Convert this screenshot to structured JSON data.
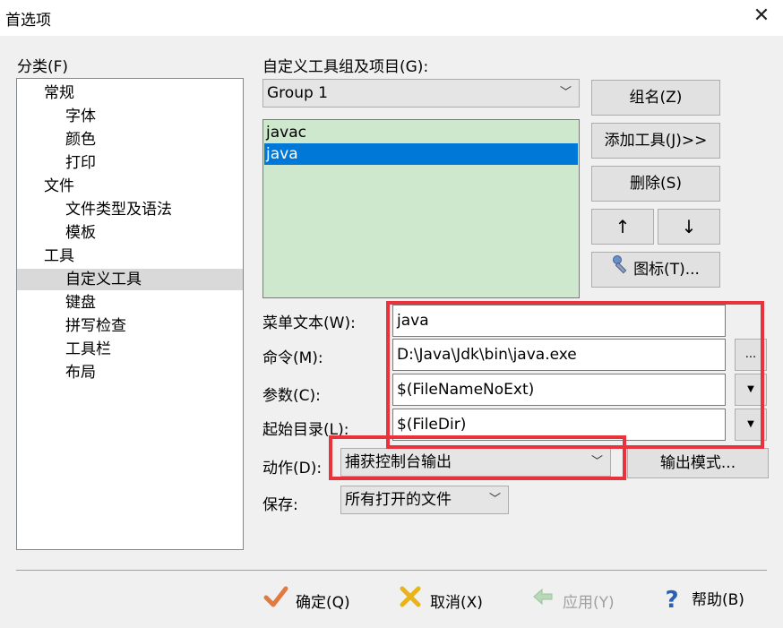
{
  "window": {
    "title": "首选项",
    "close_icon": "close-icon"
  },
  "category": {
    "label": "分类(F)",
    "items": [
      {
        "label": "常规",
        "level": 0
      },
      {
        "label": "字体",
        "level": 1
      },
      {
        "label": "颜色",
        "level": 1
      },
      {
        "label": "打印",
        "level": 1
      },
      {
        "label": "文件",
        "level": 0
      },
      {
        "label": "文件类型及语法",
        "level": 1
      },
      {
        "label": "模板",
        "level": 1
      },
      {
        "label": "工具",
        "level": 0
      },
      {
        "label": "自定义工具",
        "level": 1,
        "selected": true
      },
      {
        "label": "键盘",
        "level": 1
      },
      {
        "label": "拼写检查",
        "level": 1
      },
      {
        "label": "工具栏",
        "level": 1
      },
      {
        "label": "布局",
        "level": 1
      }
    ]
  },
  "tools": {
    "group_label": "自定义工具组及项目(G):",
    "group_selected": "Group 1",
    "list": [
      {
        "label": "javac",
        "selected": false
      },
      {
        "label": "java",
        "selected": true
      }
    ],
    "buttons": {
      "group_name": "组名(Z)",
      "add_tool": "添加工具(J)>>",
      "delete": "删除(S)",
      "up": "↑",
      "down": "↓",
      "icon": "图标(T)..."
    }
  },
  "fields": {
    "menu_text": {
      "label": "菜单文本(W):",
      "value": "java"
    },
    "command": {
      "label": "命令(M):",
      "value": "D:\\Java\\Jdk\\bin\\java.exe",
      "browse": "..."
    },
    "args": {
      "label": "参数(C):",
      "value": "$(FileNameNoExt)"
    },
    "start_dir": {
      "label": "起始目录(L):",
      "value": "$(FileDir)"
    },
    "action": {
      "label": "动作(D):",
      "value": "捕获控制台输出",
      "output_mode": "输出模式..."
    },
    "save": {
      "label": "保存:",
      "value": "所有打开的文件"
    }
  },
  "footer": {
    "ok": "确定(Q)",
    "cancel": "取消(X)",
    "apply": "应用(Y)",
    "help": "帮助(B)"
  },
  "colors": {
    "highlight_red": "#e8323c",
    "list_bg": "#cde8cd",
    "selection": "#0078d7"
  }
}
